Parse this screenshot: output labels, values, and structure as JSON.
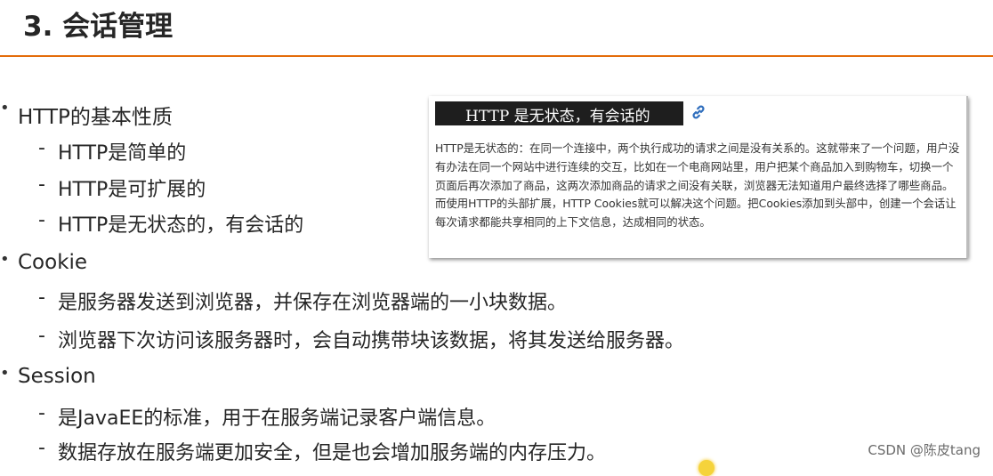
{
  "slide": {
    "title": "3. 会话管理",
    "bullets": [
      {
        "text": "HTTP的基本性质",
        "subs": [
          "HTTP是简单的",
          "HTTP是可扩展的",
          "HTTP是无状态的，有会话的"
        ]
      },
      {
        "text": "Cookie",
        "subs": [
          "是服务器发送到浏览器，并保存在浏览器端的一小块数据。",
          "浏览器下次访问该服务器时，会自动携带块该数据，将其发送给服务器。"
        ]
      },
      {
        "text": "Session",
        "subs": [
          "是JavaEE的标准，用于在服务端记录客户端信息。",
          "数据存放在服务端更加安全，但是也会增加服务端的内存压力。"
        ]
      }
    ]
  },
  "card": {
    "heading": "HTTP 是无状态，有会话的",
    "link_icon": "link-icon",
    "body": "HTTP是无状态的：在同一个连接中，两个执行成功的请求之间是没有关系的。这就带来了一个问题，用户没有办法在同一个网站中进行连续的交互，比如在一个电商网站里，用户把某个商品加入到购物车，切换一个页面后再次添加了商品，这两次添加商品的请求之间没有关联，浏览器无法知道用户最终选择了哪些商品。而使用HTTP的头部扩展，HTTP Cookies就可以解决这个问题。把Cookies添加到头部中，创建一个会话让每次请求都能共享相同的上下文信息，达成相同的状态。"
  },
  "watermark": "CSDN @陈皮tang",
  "colors": {
    "accent_rule": "#e46c0a",
    "heading_bg": "#1e1e1e",
    "link": "#2f6ebd"
  }
}
